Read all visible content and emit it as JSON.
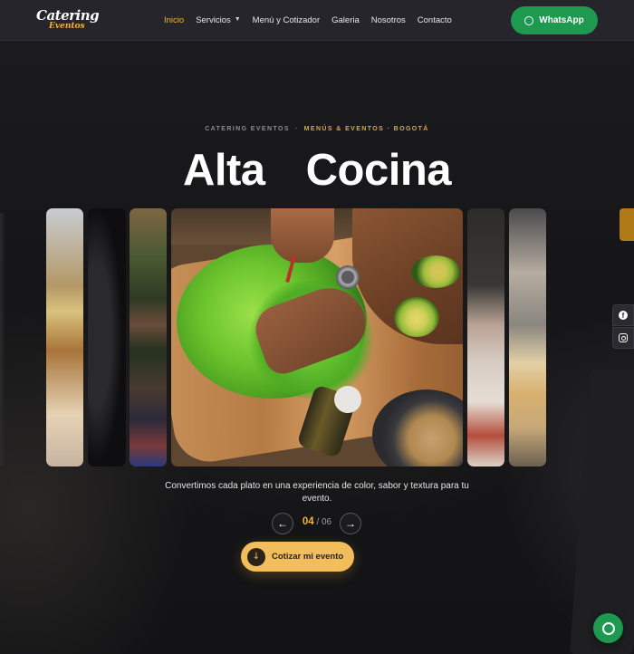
{
  "brand": {
    "logo_line1": "Catering",
    "logo_line2": "Eventos"
  },
  "nav": {
    "items": [
      {
        "label": "Inicio",
        "active": true
      },
      {
        "label": "Servicios",
        "has_dropdown": true
      },
      {
        "label": "Menú y Cotizador"
      },
      {
        "label": "Galeria"
      },
      {
        "label": "Nosotros"
      },
      {
        "label": "Contacto"
      }
    ],
    "whatsapp_label": "WhatsApp"
  },
  "hero": {
    "eyebrow_left": "CATERING EVENTOS",
    "eyebrow_sep": "·",
    "eyebrow_right": "MENÚS & EVENTOS · BOGOTÁ",
    "headline_word1": "Alta",
    "headline_word2": "Cocina",
    "caption": "Convertimos cada plato en una experiencia de color, sabor y textura para tu evento.",
    "slide_current": "04",
    "slide_total": "/ 06",
    "prev_icon": "←",
    "next_icon": "→",
    "cta_label": "Cotizar mi evento",
    "cta_icon": "↓"
  },
  "social": {
    "facebook_icon": "f"
  },
  "icons": {
    "whatsapp": "whatsapp-icon",
    "facebook": "facebook-icon",
    "instagram": "instagram-icon",
    "chevron": "chevron-down-icon"
  },
  "colors": {
    "accent_gold": "#f0b43c",
    "whatsapp_green": "#1d9a4f",
    "nav_bg": "#25252b",
    "page_bg": "#17171a"
  }
}
